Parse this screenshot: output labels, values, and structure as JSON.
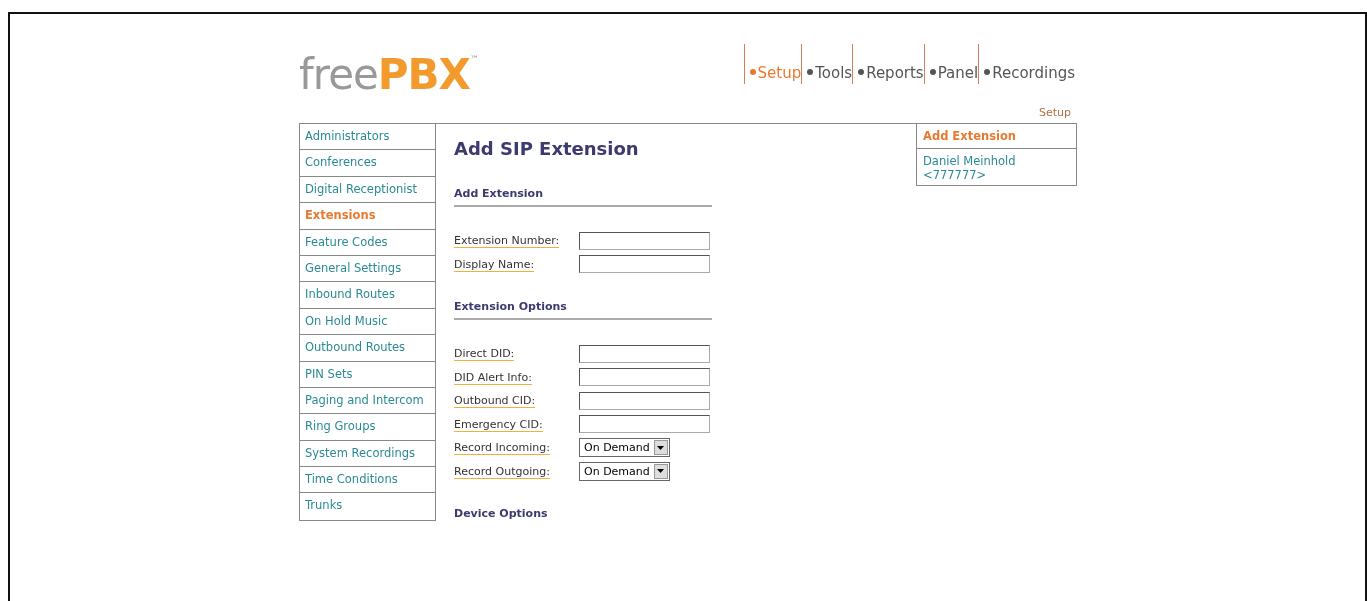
{
  "logo": {
    "light": "free",
    "bold": "PBX",
    "mark": "™"
  },
  "nav": [
    {
      "label": "Setup",
      "selected": true
    },
    {
      "label": "Tools",
      "selected": false
    },
    {
      "label": "Reports",
      "selected": false
    },
    {
      "label": "Panel",
      "selected": false
    },
    {
      "label": "Recordings",
      "selected": false
    }
  ],
  "breadcrumb": "Setup",
  "sidebar": {
    "items": [
      {
        "label": "Administrators",
        "selected": false
      },
      {
        "label": "Conferences",
        "selected": false
      },
      {
        "label": "Digital Receptionist",
        "selected": false
      },
      {
        "label": "Extensions",
        "selected": true
      },
      {
        "label": "Feature Codes",
        "selected": false
      },
      {
        "label": "General Settings",
        "selected": false
      },
      {
        "label": "Inbound Routes",
        "selected": false
      },
      {
        "label": "On Hold Music",
        "selected": false
      },
      {
        "label": "Outbound Routes",
        "selected": false
      },
      {
        "label": "PIN Sets",
        "selected": false
      },
      {
        "label": "Paging and Intercom",
        "selected": false
      },
      {
        "label": "Ring Groups",
        "selected": false
      },
      {
        "label": "System Recordings",
        "selected": false
      },
      {
        "label": "Time Conditions",
        "selected": false
      },
      {
        "label": "Trunks",
        "selected": false
      }
    ]
  },
  "title": "Add SIP Extension",
  "sections": [
    {
      "heading": "Add Extension",
      "fields": [
        {
          "label": "Extension Number:",
          "kind": "text"
        },
        {
          "label": "Display Name:",
          "kind": "text"
        }
      ]
    },
    {
      "heading": "Extension Options",
      "fields": [
        {
          "label": "Direct DID:",
          "kind": "text"
        },
        {
          "label": "DID Alert Info:",
          "kind": "text"
        },
        {
          "label": "Outbound CID:",
          "kind": "text"
        },
        {
          "label": "Emergency CID:",
          "kind": "text"
        },
        {
          "label": "Record Incoming:",
          "kind": "select",
          "value": "On Demand"
        },
        {
          "label": "Record Outgoing:",
          "kind": "select",
          "value": "On Demand"
        }
      ]
    },
    {
      "heading": "Device Options"
    }
  ],
  "right_panel": {
    "items": [
      {
        "label": "Add Extension",
        "selected": true
      },
      {
        "label": "Daniel Meinhold <777777>",
        "selected": false
      }
    ]
  }
}
